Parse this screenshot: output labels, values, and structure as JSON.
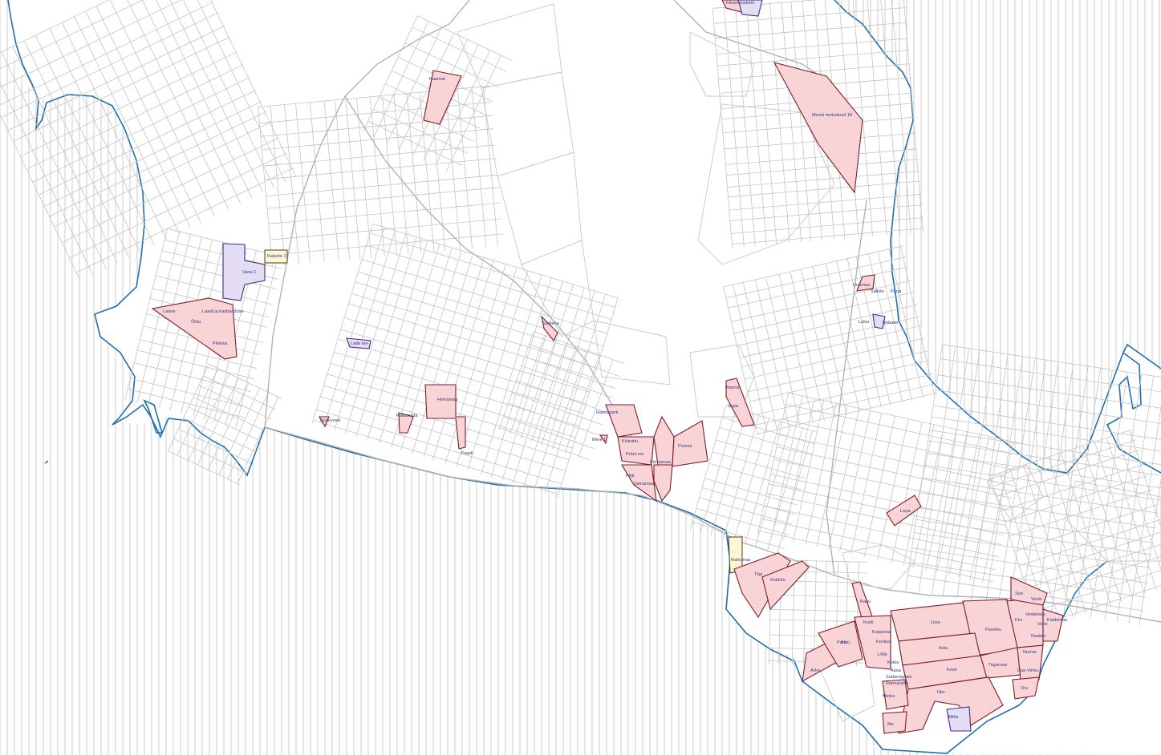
{
  "map": {
    "colors": {
      "sea_hatch": "#b8b8b8",
      "coastline": "#1f6fae",
      "street": "#c4c4c4",
      "parcel_pink_fill": "#f9d4d6",
      "parcel_pink_stroke": "#7b1c2a",
      "parcel_lilac_fill": "#e3def5",
      "parcel_yellow_fill": "#fdf6d3"
    },
    "labels": {
      "kitsenduskoht": "Kitsenduskoht",
      "raamat": "Raamat",
      "mooni_metsakool": "Mooni metsakool 18",
      "kalurite_1": "Kalurite 1",
      "vana_1": "Vana 1",
      "lade_tee": "Lade tee",
      "laadi_ja_kaubanduse": "Laadi ja kaubanduse",
      "kallasrada": "Kallasrada",
      "heinamaa": "Heinamaa",
      "sadama": "Sadama",
      "rannapark": "Rannapark",
      "mere_1": "Mere 1",
      "paadi": "Paadi",
      "kivirahu": "Kivirahu",
      "prani_nm": "Präni nm",
      "parnamaa": "Pärnamaa",
      "pikk": "Pikk",
      "seinamaa": "Seinamaa",
      "pommi": "Pommi",
      "ranna": "Ranna",
      "uuemaa": "Uuemaa",
      "luksi": "Luksi",
      "saliste": "Saliste",
      "tiigi": "Tiigi",
      "rahumaa": "Rahumaa",
      "koidula": "Koidula",
      "rahu": "Rahu",
      "arho": "Arho",
      "lepa": "Lepa",
      "parki": "Parki",
      "kooli": "Kooli",
      "liiva": "Liiva",
      "pasteku": "Pasteku",
      "pargi": "Pargi",
      "asta": "Asta",
      "rebase": "Rebase",
      "kesk": "Kesk",
      "tagumaa": "Tagumaa",
      "uue_virtsu": "Uue-Virtsu",
      "nurme": "Nurme",
      "oru": "Oru",
      "kivi": "Kivi",
      "sepa": "Sepa",
      "vahe": "Vahe",
      "kaldemaa": "Kaldemaa",
      "hiie": "Hiie",
      "metsa": "Metsa",
      "joe": "Jõe",
      "allika": "Allika",
      "naaber": "Naaber",
      "veski": "Veski",
      "soo": "Soo",
      "veskimaa": "Veskimaa",
      "karjamaa": "Karjamaa",
      "keskus": "Keskus",
      "lokk": "Lõkk",
      "kotka": "Kotka",
      "aasa": "Aasa",
      "sadamaplats": "Sadamaplats",
      "rannarahu": "Rannarahu",
      "kirsi": "Kirsi",
      "laane": "Laane",
      "ohtu": "Õhtu",
      "pihlaka": "Pihlaka",
      "tuuleveski": "Tuuleveski"
    }
  }
}
